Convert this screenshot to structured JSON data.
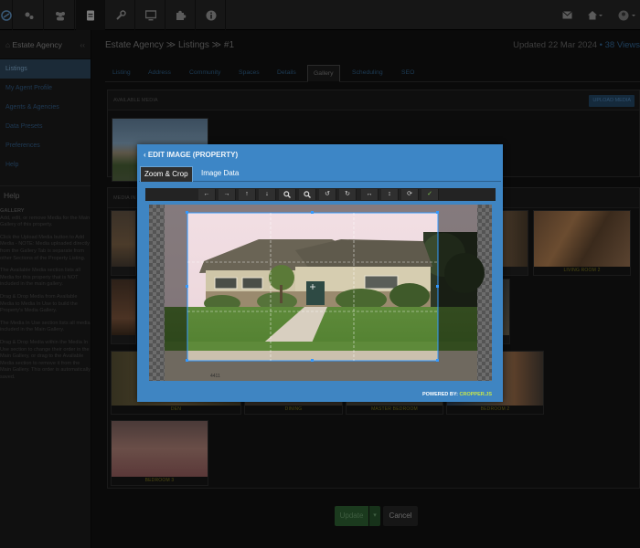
{
  "topbar": {
    "icons": [
      "logo-icon",
      "gears-icon",
      "users-icon",
      "document-icon",
      "wrench-icon",
      "monitor-icon",
      "puzzle-icon",
      "info-icon"
    ],
    "right_icons": [
      "mail-icon",
      "home-icon",
      "user-icon"
    ]
  },
  "sidebar": {
    "title": "Estate Agency",
    "items": [
      {
        "label": "Listings"
      },
      {
        "label": "My Agent Profile"
      },
      {
        "label": "Agents & Agencies"
      },
      {
        "label": "Data Presets"
      },
      {
        "label": "Preferences"
      },
      {
        "label": "Help"
      }
    ],
    "help_title": "Help",
    "help": {
      "heading": "GALLERY",
      "p1": "Add, edit, or remove Media for the Main Gallery of this property.",
      "p2": "Click the Upload Media button to Add Media - NOTE: Media uploaded directly from the Gallery Tab is separate from other Sections of the Property Listing.",
      "p3": "The Available Media section lists all Media for this property that is NOT included in the main gallery.",
      "p4": "Drag & Drop Media from Available Media to Media In Use to build the Property's Media Gallery.",
      "p5": "The Media In Use section lists all media included in the Main Gallery.",
      "p6": "Drag & Drop Media within the Media In Use section to change their order in the Main Gallery, or drag to the Available Media section to remove it from the Main Gallery. This order is automatically saved."
    }
  },
  "header": {
    "breadcrumb": "Estate Agency ≫ Listings ≫ #1",
    "updated": "Updated 22 Mar 2024",
    "views": "• 38 Views"
  },
  "tabs": [
    "Listing",
    "Address",
    "Community",
    "Spaces",
    "Details",
    "Gallery",
    "Scheduling",
    "SEO"
  ],
  "available": {
    "title": "AVAILABLE MEDIA",
    "upload": "UPLOAD MEDIA"
  },
  "inuse": {
    "title": "MEDIA IN USE"
  },
  "captions": [
    "LIVING ROOM 2",
    "DEN",
    "DINING",
    "MASTER BEDROOM",
    "BEDROOM 2",
    "BEDROOM 3"
  ],
  "buttons": {
    "update": "Update",
    "cancel": "Cancel"
  },
  "modal": {
    "title": "‹ EDIT IMAGE (PROPERTY)",
    "tabs": [
      "Zoom & Crop",
      "Image Data"
    ],
    "toolbar": [
      "←",
      "→",
      "↑",
      "↓",
      "🔍︎",
      "🔍︎",
      "↺",
      "↻",
      "↔",
      "↕",
      "⟳",
      "✓"
    ],
    "toolbar_icons": [
      "move-left-icon",
      "move-right-icon",
      "move-up-icon",
      "move-down-icon",
      "zoom-in-icon",
      "zoom-out-icon",
      "rotate-left-icon",
      "rotate-right-icon",
      "flip-horizontal-icon",
      "flip-vertical-icon",
      "reset-icon",
      "apply-icon"
    ],
    "powered_by": "POWERED BY:",
    "library": "CROPPER.JS"
  },
  "colors": {
    "accent": "#3d86c6",
    "ok": "#7ec34d",
    "caption": "#4e4a12"
  }
}
